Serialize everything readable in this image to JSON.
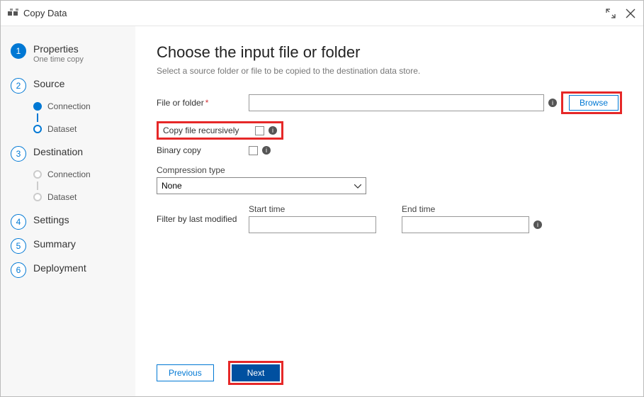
{
  "header": {
    "title": "Copy Data"
  },
  "sidebar": {
    "steps": [
      {
        "num": "1",
        "label": "Properties",
        "sub": "One time copy"
      },
      {
        "num": "2",
        "label": "Source"
      },
      {
        "num": "3",
        "label": "Destination"
      },
      {
        "num": "4",
        "label": "Settings"
      },
      {
        "num": "5",
        "label": "Summary"
      },
      {
        "num": "6",
        "label": "Deployment"
      }
    ],
    "source_substeps": {
      "connection": "Connection",
      "dataset": "Dataset"
    },
    "dest_substeps": {
      "connection": "Connection",
      "dataset": "Dataset"
    }
  },
  "main": {
    "heading": "Choose the input file or folder",
    "subtitle": "Select a source folder or file to be copied to the destination data store.",
    "file_label": "File or folder",
    "browse": "Browse",
    "recursive_label": "Copy file recursively",
    "binary_label": "Binary copy",
    "compression_label": "Compression type",
    "compression_value": "None",
    "filter_label": "Filter by last modified",
    "start_label": "Start time",
    "end_label": "End time"
  },
  "footer": {
    "previous": "Previous",
    "next": "Next"
  }
}
